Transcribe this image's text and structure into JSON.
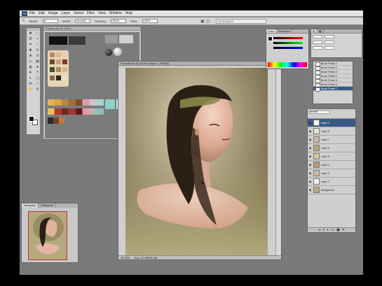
{
  "app": {
    "logo": "Ps",
    "menu": [
      "File",
      "Edit",
      "Image",
      "Layer",
      "Select",
      "Filter",
      "View",
      "Window",
      "Help"
    ]
  },
  "options_bar": {
    "brush_label": "Brush:",
    "mode_label": "Mode:",
    "mode_value": "Normal",
    "opacity_label": "Opacity:",
    "opacity_value": "100%",
    "flow_label": "Flow:",
    "flow_value": "100%",
    "workspace_placeholder": "Workspace"
  },
  "tools": [
    "move-tool",
    "marquee-tool",
    "lasso-tool",
    "magic-wand-tool",
    "crop-tool",
    "slice-tool",
    "healing-tool",
    "brush-tool",
    "clone-stamp-tool",
    "history-brush-tool",
    "eraser-tool",
    "gradient-tool",
    "blur-tool",
    "dodge-tool",
    "pen-tool",
    "type-tool",
    "path-select-tool",
    "shape-tool",
    "notes-tool",
    "eyedropper-tool",
    "hand-tool",
    "zoom-tool"
  ],
  "tool_glyphs": [
    "✥",
    "⬚",
    "ʘ",
    "✧",
    "⌗",
    "⟋",
    "✚",
    "✎",
    "⊛",
    "↺",
    "▭",
    "▤",
    "◍",
    "●",
    "✒",
    "T",
    "↖",
    "▢",
    "✉",
    "⁄",
    "✋",
    "⚲"
  ],
  "palette_doc": {
    "title": "Palette.psd @ 100%"
  },
  "document": {
    "title": "Portrait.psd @ 33.3% (Layer 1, RGB/8)",
    "status_zoom": "33.33%",
    "status_doc": "Doc: 12.4M/68.2M"
  },
  "navigator": {
    "tabs": [
      "Navigator",
      "Histogram"
    ]
  },
  "color_panel": {
    "tabs": [
      "Color",
      "Swatches"
    ]
  },
  "brushes": {
    "items": [
      "Brush Preset 1",
      "Brush Preset 2",
      "Brush Preset 3",
      "Brush Preset 4",
      "Brush Preset 5",
      "Brush Preset 6",
      "Brush Preset 7"
    ]
  },
  "layers": {
    "blend_mode": "Normal",
    "items": [
      "Layer 9",
      "Layer 8",
      "Layer 7",
      "Layer 6",
      "Layer 5",
      "Layer 4",
      "Layer 3",
      "Layer 2",
      "Background"
    ]
  },
  "colors": {
    "accent": "#3a5a86",
    "workspace_bg": "#7a7a7a",
    "canvas_bg": "#b6ab80"
  }
}
